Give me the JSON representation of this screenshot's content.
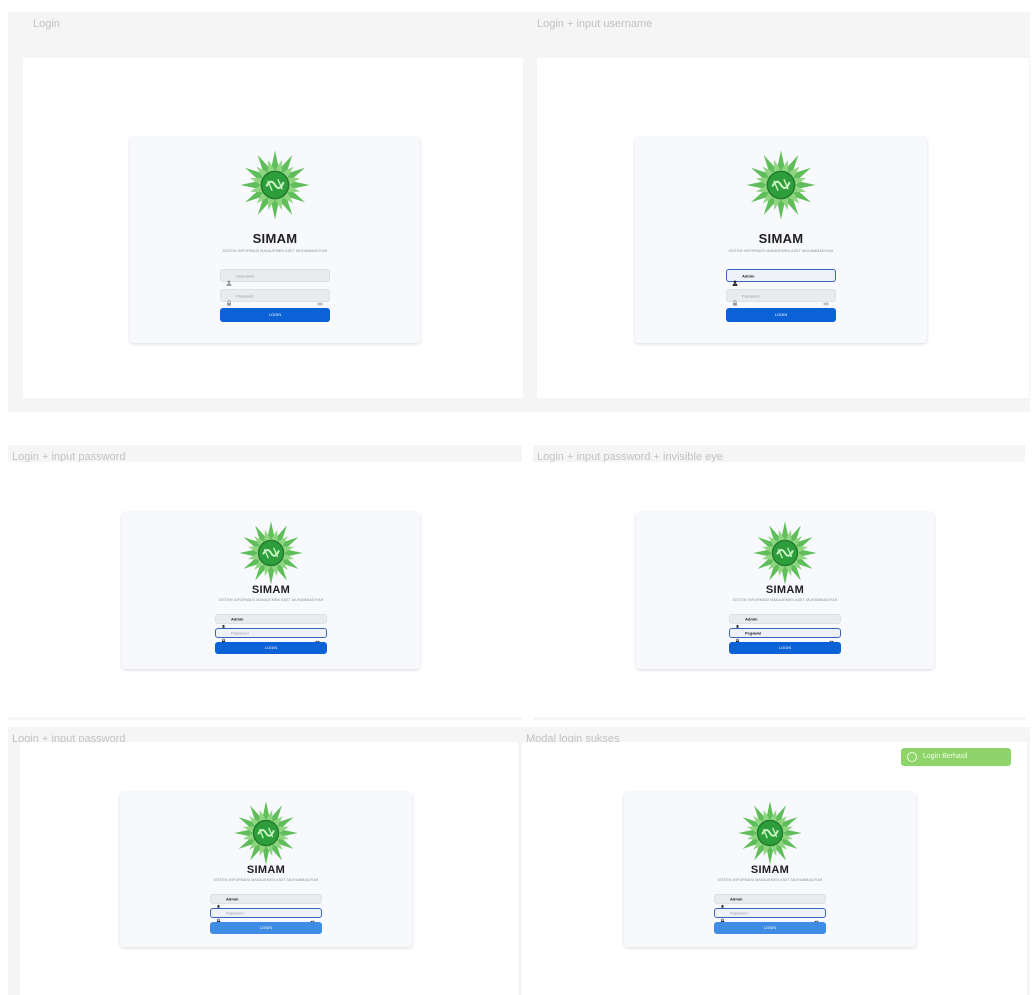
{
  "app": {
    "brand": "SIMAM",
    "subtitle": "SISTEM INFORMASI MANAJEMEN ASET MUHAMMADIYAH",
    "login_label": "LOGIN",
    "username_placeholder": "Username",
    "password_placeholder": "Password",
    "username_value": "Admin",
    "password_masked": "••••••••",
    "password_visible": "Pegawai"
  },
  "frames": [
    {
      "title": "Login"
    },
    {
      "title": "Login + input username"
    },
    {
      "title": "Login + input password"
    },
    {
      "title": "Login + input password + invisible eye"
    },
    {
      "title": "Login + input password"
    },
    {
      "title": "Modal login sukses"
    }
  ],
  "toast": {
    "label": "Login Berhasil"
  },
  "colors": {
    "primary": "#0b62d6",
    "focus_border": "#3b64b8",
    "success": "#8fd46a",
    "logo_green": "#2e9e3c"
  },
  "icons": [
    "user-icon",
    "lock-icon",
    "eye-icon",
    "logo-emblem-icon",
    "check-circle-icon"
  ]
}
